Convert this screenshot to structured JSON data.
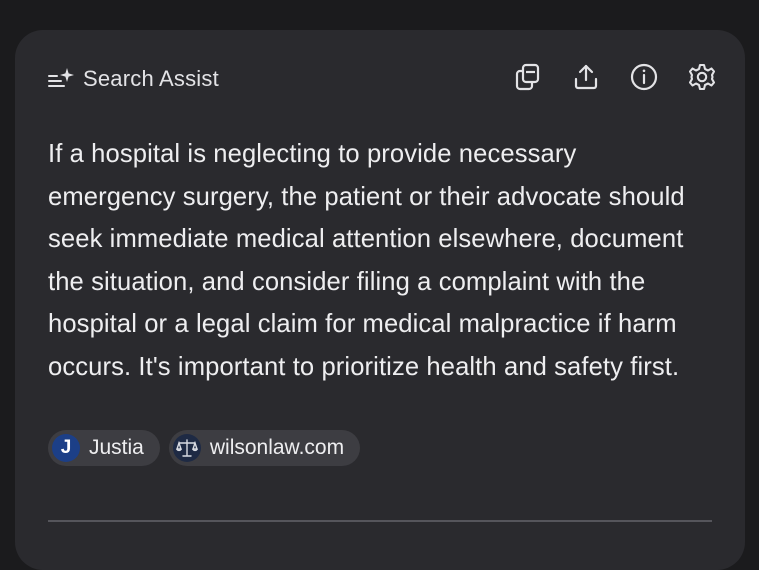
{
  "header": {
    "title": "Search Assist",
    "title_icon": "sparkle-list-icon",
    "actions": [
      {
        "icon": "copy-icon"
      },
      {
        "icon": "share-icon"
      },
      {
        "icon": "info-icon"
      },
      {
        "icon": "gear-icon"
      }
    ]
  },
  "answer": {
    "text": "If a hospital is neglecting to provide necessary emergency surgery, the patient or their advocate should seek immediate medical attention elsewhere, document the situation, and consider filing a complaint with the hospital or a legal claim for medical malpractice if harm occurs. It's important to prioritize health and safety first."
  },
  "sources": [
    {
      "label": "Justia",
      "logo_letter": "J"
    },
    {
      "label": "wilsonlaw.com"
    }
  ],
  "colors": {
    "background": "#1b1b1d",
    "card": "#2a2a2e",
    "chip": "#3d3d42",
    "text": "#eeeef0",
    "justia_logo": "#1c3f87"
  }
}
